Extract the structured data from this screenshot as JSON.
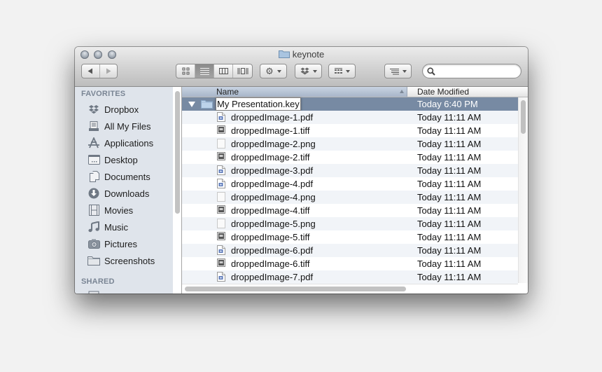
{
  "window": {
    "title": "keynote",
    "title_icon": "folder-icon"
  },
  "toolbar": {
    "back_icon": "back-arrow-icon",
    "forward_icon": "forward-arrow-icon",
    "view_modes": [
      {
        "name": "icon-view",
        "active": false
      },
      {
        "name": "list-view",
        "active": true
      },
      {
        "name": "column-view",
        "active": false
      },
      {
        "name": "cover-flow-view",
        "active": false
      }
    ],
    "action_menu_icon": "gear-icon",
    "dropbox_menu_icon": "dropbox-icon",
    "arrange_menu_icon": "arrange-grid-icon",
    "sort_menu_icon": "list-sort-icon",
    "search": {
      "placeholder": "",
      "value": ""
    }
  },
  "sidebar": {
    "favorites_header": "FAVORITES",
    "items": [
      {
        "label": "Dropbox",
        "icon": "dropbox-icon"
      },
      {
        "label": "All My Files",
        "icon": "all-files-icon"
      },
      {
        "label": "Applications",
        "icon": "applications-icon"
      },
      {
        "label": "Desktop",
        "icon": "desktop-icon"
      },
      {
        "label": "Documents",
        "icon": "documents-icon"
      },
      {
        "label": "Downloads",
        "icon": "downloads-icon"
      },
      {
        "label": "Movies",
        "icon": "movies-icon"
      },
      {
        "label": "Music",
        "icon": "music-icon"
      },
      {
        "label": "Pictures",
        "icon": "pictures-icon"
      },
      {
        "label": "Screenshots",
        "icon": "folder-icon"
      }
    ],
    "shared_header": "SHARED"
  },
  "columns": {
    "name": "Name",
    "date_modified": "Date Modified",
    "sort_direction": "ascending"
  },
  "files": [
    {
      "name": "My Presentation.key",
      "date": "Today 6:40 PM",
      "type": "folder",
      "expanded": true,
      "selected": true,
      "editing": true
    },
    {
      "name": "droppedImage-1.pdf",
      "date": "Today 11:11 AM",
      "type": "pdf"
    },
    {
      "name": "droppedImage-1.tiff",
      "date": "Today 11:11 AM",
      "type": "tiff"
    },
    {
      "name": "droppedImage-2.png",
      "date": "Today 11:11 AM",
      "type": "png"
    },
    {
      "name": "droppedImage-2.tiff",
      "date": "Today 11:11 AM",
      "type": "tiff"
    },
    {
      "name": "droppedImage-3.pdf",
      "date": "Today 11:11 AM",
      "type": "pdf"
    },
    {
      "name": "droppedImage-4.pdf",
      "date": "Today 11:11 AM",
      "type": "pdf"
    },
    {
      "name": "droppedImage-4.png",
      "date": "Today 11:11 AM",
      "type": "png"
    },
    {
      "name": "droppedImage-4.tiff",
      "date": "Today 11:11 AM",
      "type": "tiff"
    },
    {
      "name": "droppedImage-5.png",
      "date": "Today 11:11 AM",
      "type": "png"
    },
    {
      "name": "droppedImage-5.tiff",
      "date": "Today 11:11 AM",
      "type": "tiff"
    },
    {
      "name": "droppedImage-6.pdf",
      "date": "Today 11:11 AM",
      "type": "pdf"
    },
    {
      "name": "droppedImage-6.tiff",
      "date": "Today 11:11 AM",
      "type": "tiff"
    },
    {
      "name": "droppedImage-7.pdf",
      "date": "Today 11:11 AM",
      "type": "pdf"
    }
  ],
  "colors": {
    "selection": "#778aa3",
    "sidebar_bg": "#dfe4eb",
    "sidebar_header": "#7a8594"
  }
}
